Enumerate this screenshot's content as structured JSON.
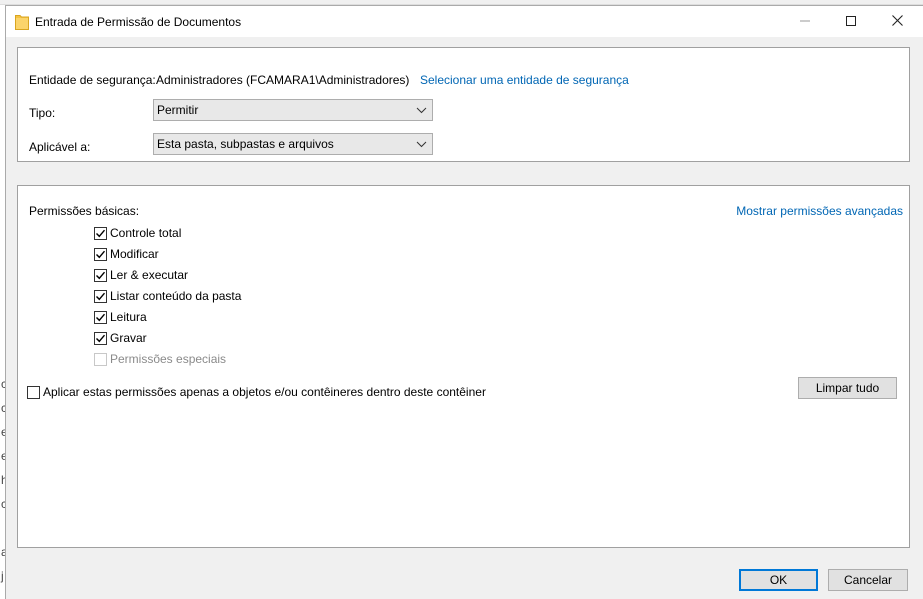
{
  "background": {
    "letters": [
      "c",
      "c",
      "e",
      "e",
      "h",
      "c",
      "a",
      "j"
    ]
  },
  "window": {
    "title": "Entrada de Permissão de Documentos",
    "icons": {
      "app": "folder-icon",
      "minimize": "minimize-icon",
      "maximize": "maximize-icon",
      "close": "close-icon"
    }
  },
  "principal": {
    "label": "Entidade de segurança:",
    "value": "Administradores (FCAMARA1\\Administradores)",
    "select_link": "Selecionar uma entidade de segurança"
  },
  "type": {
    "label": "Tipo:",
    "value": "Permitir"
  },
  "applies_to": {
    "label": "Aplicável a:",
    "value": "Esta pasta, subpastas e arquivos"
  },
  "permissions": {
    "label": "Permissões básicas:",
    "advanced_link": "Mostrar permissões avançadas",
    "items": [
      {
        "label": "Controle total",
        "checked": true,
        "enabled": true
      },
      {
        "label": "Modificar",
        "checked": true,
        "enabled": true
      },
      {
        "label": "Ler & executar",
        "checked": true,
        "enabled": true
      },
      {
        "label": "Listar conteúdo da pasta",
        "checked": true,
        "enabled": true
      },
      {
        "label": "Leitura",
        "checked": true,
        "enabled": true
      },
      {
        "label": "Gravar",
        "checked": true,
        "enabled": true
      },
      {
        "label": "Permissões especiais",
        "checked": false,
        "enabled": false
      }
    ]
  },
  "apply_only": {
    "label": "Aplicar estas permissões apenas a objetos e/ou contêineres dentro deste contêiner",
    "checked": false
  },
  "buttons": {
    "clear_all": "Limpar tudo",
    "ok": "OK",
    "cancel": "Cancelar"
  },
  "colors": {
    "link": "#0066b4",
    "default_button_border": "#0078d7",
    "folder": "#f5c342"
  }
}
